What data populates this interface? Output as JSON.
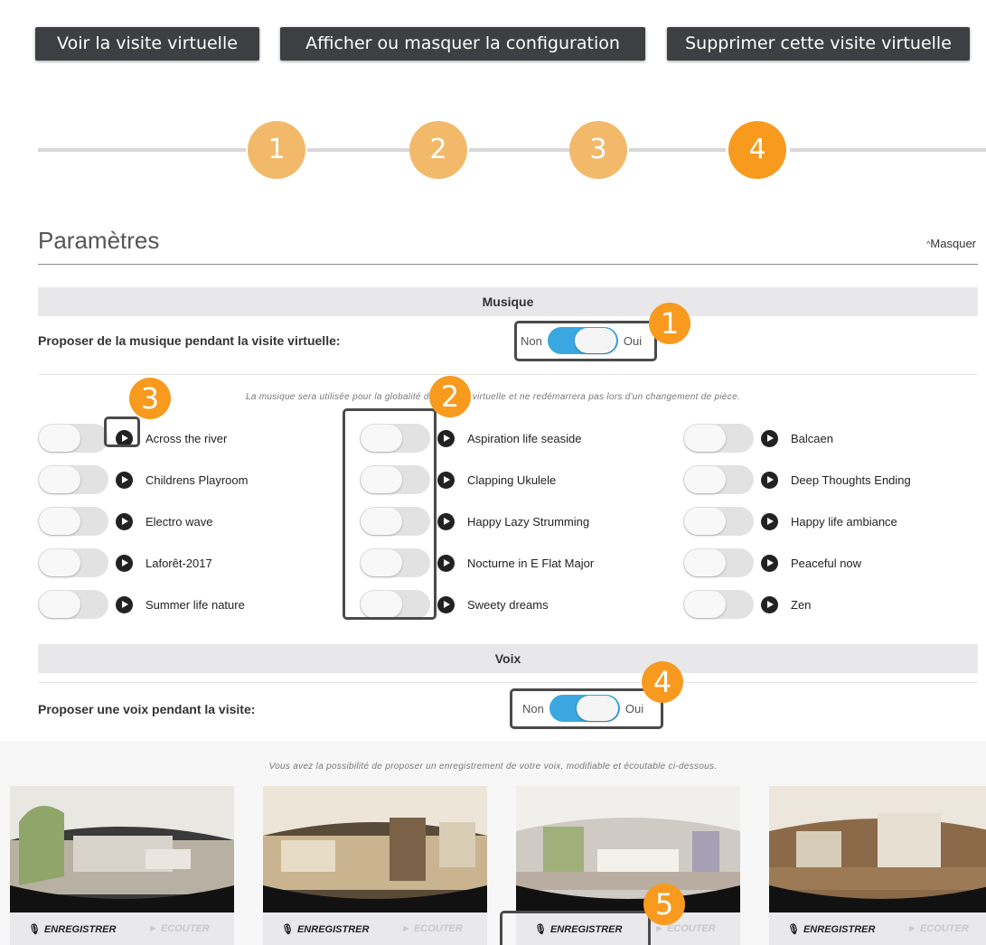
{
  "toolbar": {
    "voir_label": "Voir la visite virtuelle",
    "afficher_label": "Afficher ou masquer la configuration",
    "supprimer_label": "Supprimer cette visite virtuelle"
  },
  "stepper": {
    "steps": [
      "1",
      "2",
      "3",
      "4"
    ],
    "active_step": 4
  },
  "parametres": {
    "title": "Paramètres",
    "masquer_label": "Masquer",
    "masquer_icon": "chevron-up-icon"
  },
  "musique": {
    "band_title": "Musique",
    "question": "Proposer de la musique pendant la visite virtuelle:",
    "toggle_off": "Non",
    "toggle_on": "Oui",
    "enabled": true,
    "note": "La musique sera utilisée pour la globalité de la visite virtuelle et ne redémarrera pas lors d'un changement de pièce.",
    "columns": [
      [
        "Across the river",
        "Childrens Playroom",
        "Electro wave",
        "Laforêt-2017",
        "Summer life nature"
      ],
      [
        "Aspiration life seaside",
        "Clapping Ukulele",
        "Happy Lazy Strumming",
        "Nocturne in E Flat Major",
        "Sweety dreams"
      ],
      [
        "Balcaen",
        "Deep Thoughts Ending",
        "Happy life ambiance",
        "Peaceful now",
        "Zen"
      ]
    ]
  },
  "voix": {
    "band_title": "Voix",
    "question": "Proposer une voix pendant la visite:",
    "toggle_off": "Non",
    "toggle_on": "Oui",
    "enabled": true,
    "note": "Vous avez la possibilité de proposer un enregistrement de votre voix, modifiable et écoutable ci-dessous.",
    "record_label": "ENREGISTRER",
    "listen_label": "ECOUTER",
    "rooms": 4
  },
  "callouts": [
    "1",
    "2",
    "3",
    "4",
    "5"
  ],
  "colors": {
    "button_dark": "#3d3f42",
    "step_pale": "#f2b96a",
    "step_active": "#f79a1e",
    "toggle_on": "#3aa7e1",
    "callout": "#f79a1e"
  }
}
